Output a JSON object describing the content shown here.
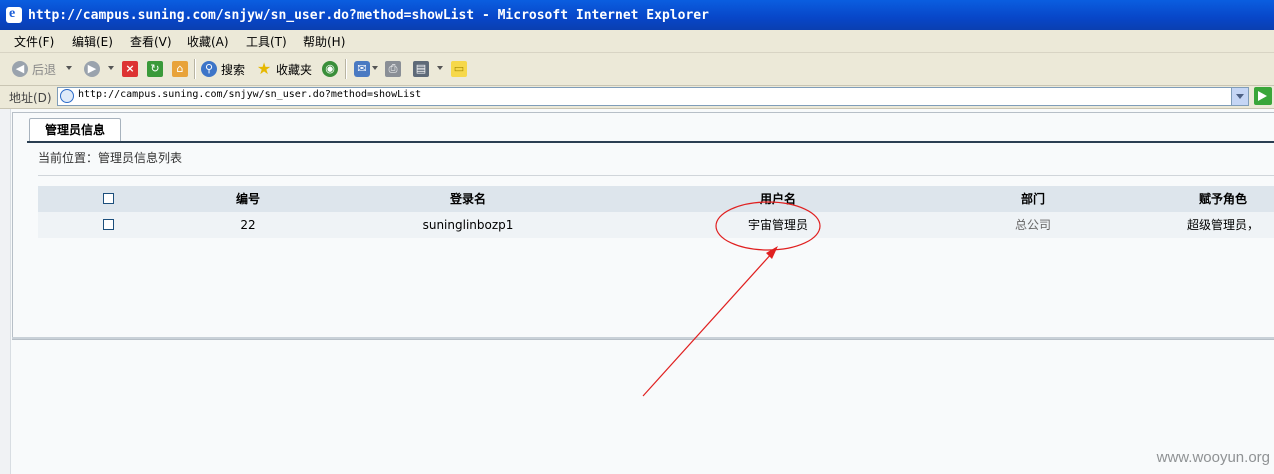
{
  "window": {
    "title": "http://campus.suning.com/snjyw/sn_user.do?method=showList - Microsoft Internet Explorer"
  },
  "menu": [
    "文件(F)",
    "编辑(E)",
    "查看(V)",
    "收藏(A)",
    "工具(T)",
    "帮助(H)"
  ],
  "toolbar": {
    "back": "后退",
    "search": "搜索",
    "favorites": "收藏夹"
  },
  "address": {
    "label": "地址(D)",
    "url": "http://campus.suning.com/snjyw/sn_user.do?method=showList"
  },
  "page": {
    "tab": "管理员信息",
    "breadcrumb": "当前位置：管理员信息列表",
    "table": {
      "headers": {
        "id": "编号",
        "login": "登录名",
        "username": "用户名",
        "dept": "部门",
        "role": "赋予角色"
      },
      "rows": [
        {
          "id": "22",
          "login": "suninglinbozp1",
          "username": "宇宙管理员",
          "dept": "总公司",
          "role": "超级管理员，"
        }
      ]
    }
  },
  "annotation": {
    "color": "#e02020"
  },
  "watermark": "www.wooyun.org"
}
